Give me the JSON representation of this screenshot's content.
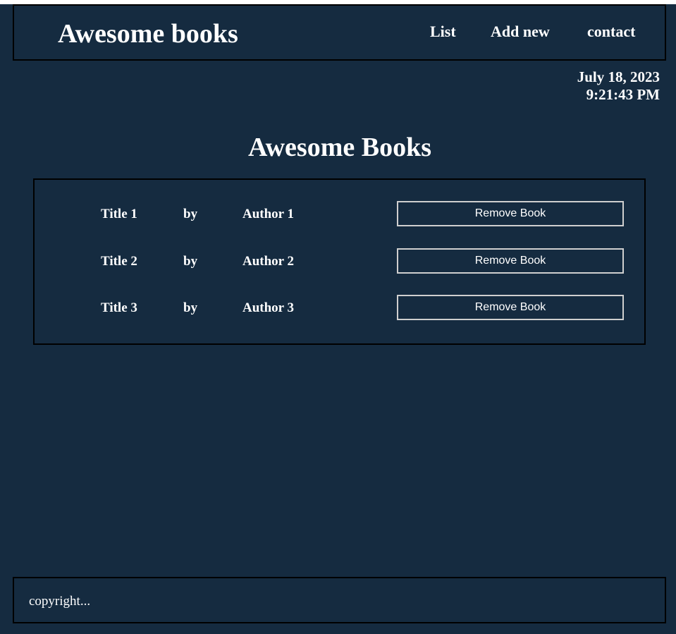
{
  "header": {
    "brand": "Awesome books",
    "nav": [
      {
        "label": "List"
      },
      {
        "label": "Add new"
      },
      {
        "label": "contact"
      }
    ]
  },
  "datetime": {
    "date": "July 18, 2023",
    "time": "9:21:43 PM"
  },
  "main": {
    "title": "Awesome Books",
    "books": [
      {
        "title": "Title 1",
        "by": "by",
        "author": "Author 1",
        "remove_label": "Remove Book"
      },
      {
        "title": "Title 2",
        "by": "by",
        "author": "Author 2",
        "remove_label": "Remove Book"
      },
      {
        "title": "Title 3",
        "by": "by",
        "author": "Author 3",
        "remove_label": "Remove Book"
      }
    ]
  },
  "footer": {
    "copyright": "copyright..."
  },
  "colors": {
    "background": "#152b40",
    "text": "#ffffff",
    "border": "#000000",
    "button_border": "#cfcfcf"
  }
}
